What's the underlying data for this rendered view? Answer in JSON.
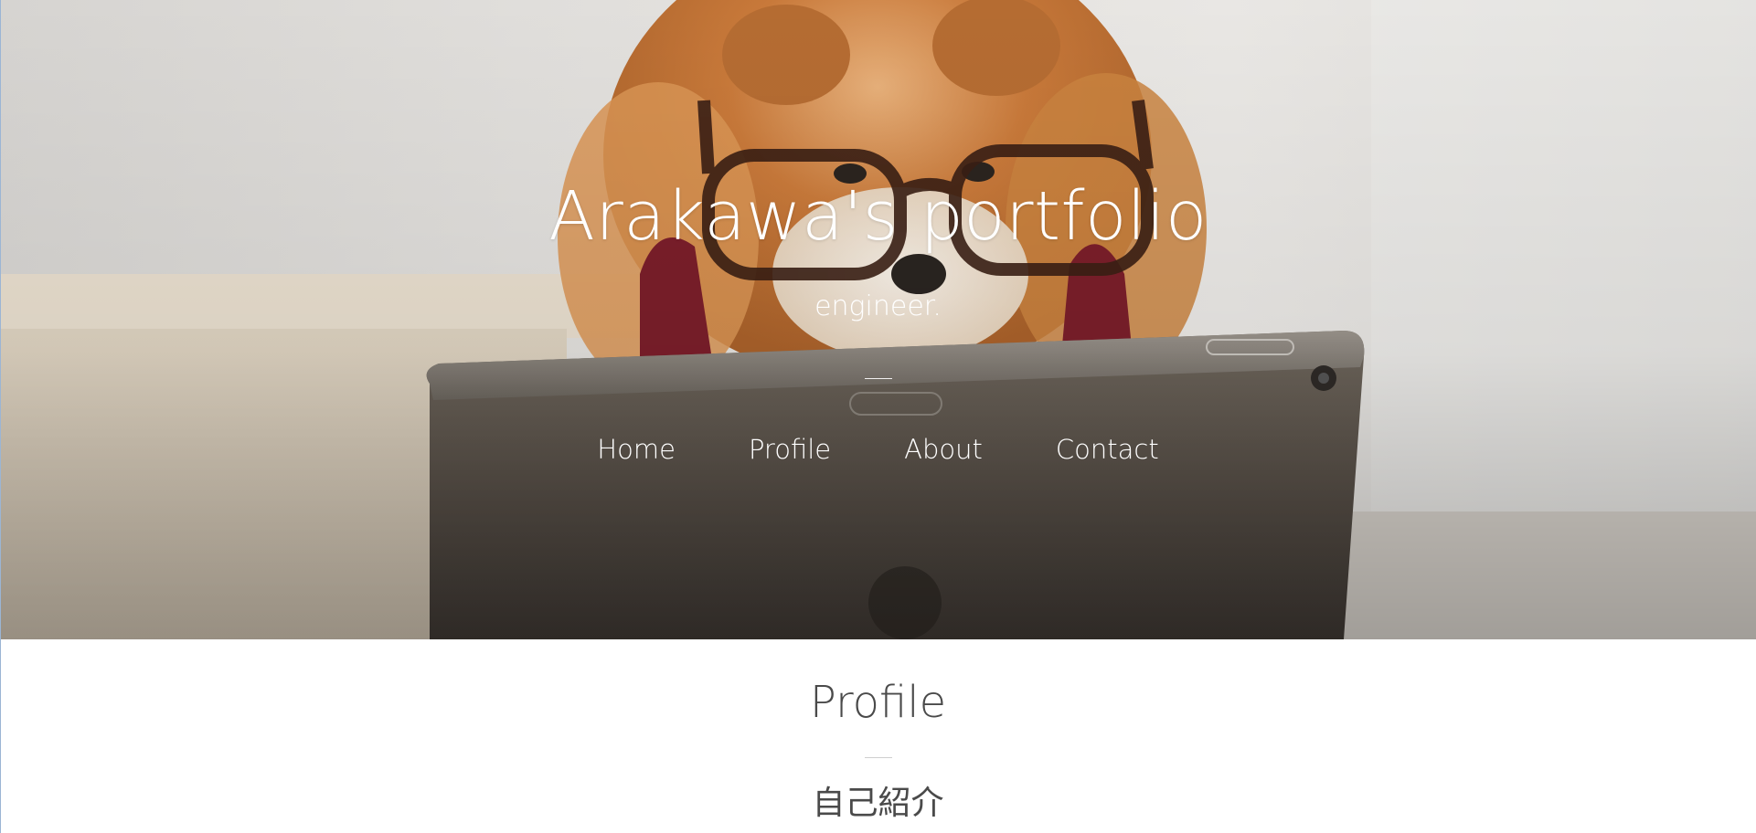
{
  "hero": {
    "title": "Arakawa's portfolio",
    "subtitle": "engineer."
  },
  "nav": {
    "items": [
      {
        "label": "Home"
      },
      {
        "label": "Profile"
      },
      {
        "label": "About"
      },
      {
        "label": "Contact"
      }
    ]
  },
  "profile": {
    "title": "Profile",
    "subtitle": "自己紹介"
  },
  "colors": {
    "hero_text": "#ffffff",
    "section_text": "#4a4a4a",
    "fur": "#c87a3c",
    "tablet": "#5a5048"
  }
}
